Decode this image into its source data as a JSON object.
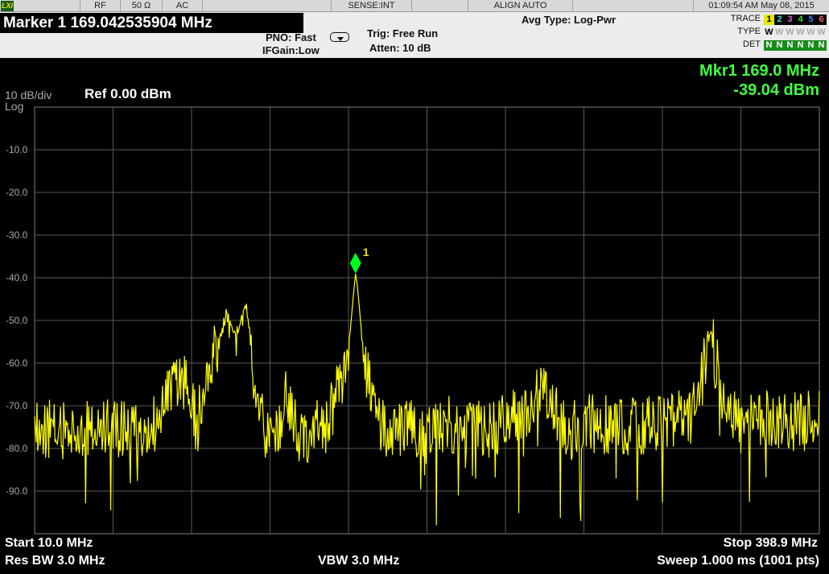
{
  "status_bar": {
    "logo": "LXI",
    "rf": "RF",
    "impedance": "50 Ω",
    "coupling": "AC",
    "sense": "SENSE:INT",
    "align": "ALIGN AUTO",
    "timestamp": "01:09:54 AM May 08, 2015"
  },
  "settings": {
    "marker_title": "Marker 1 169.042535904 MHz",
    "pno": "PNO: Fast",
    "ifgain": "IFGain:Low",
    "trig": "Trig: Free Run",
    "atten": "Atten: 10 dB",
    "avg_type": "Avg Type: Log-Pwr",
    "trace_label": "TRACE",
    "type_label": "TYPE",
    "det_label": "DET",
    "trace_numbers": [
      "1",
      "2",
      "3",
      "4",
      "5",
      "6"
    ],
    "trace_colors": [
      "#e8e800",
      "#40e0e0",
      "#e060e0",
      "#40e040",
      "#4080ff",
      "#ff6060"
    ],
    "type_values": [
      "W",
      "W",
      "W",
      "W",
      "W",
      "W"
    ],
    "det_values": [
      "N",
      "N",
      "N",
      "N",
      "N",
      "N"
    ]
  },
  "display": {
    "scale": "10 dB/div",
    "log": "Log",
    "ref": "Ref 0.00 dBm",
    "marker_readout_freq": "Mkr1 169.0 MHz",
    "marker_readout_amp": "-39.04 dBm",
    "marker_label": "1",
    "y_tick_labels": [
      "-10.0",
      "-20.0",
      "-30.0",
      "-40.0",
      "-50.0",
      "-60.0",
      "-70.0",
      "-80.0",
      "-90.0"
    ],
    "start": "Start 10.0 MHz",
    "stop": "Stop 398.9 MHz",
    "res_bw": "Res BW 3.0 MHz",
    "vbw": "VBW 3.0 MHz",
    "sweep": "Sweep  1.000 ms (1001 pts)"
  },
  "chart_data": {
    "type": "line",
    "x_start_mhz": 10.0,
    "x_stop_mhz": 398.9,
    "ylim": [
      -100,
      0
    ],
    "grid": true,
    "series_color": "#ffff00",
    "marker": {
      "x_mhz": 169.04,
      "y_dbm": -39.04
    },
    "series": [
      {
        "x_mhz": [
          10,
          25,
          40,
          55,
          70,
          75,
          85,
          90,
          95,
          100,
          105,
          110,
          115,
          120,
          125,
          130,
          135,
          140,
          145,
          155,
          165,
          168,
          169.04,
          170,
          173,
          180,
          190,
          205,
          220,
          235,
          250,
          260,
          265,
          270,
          275,
          285,
          300,
          320,
          335,
          340,
          345,
          350,
          360,
          375,
          390,
          398.9
        ],
        "y_dbm": [
          -75,
          -76,
          -75,
          -76,
          -74,
          -66,
          -64,
          -74,
          -63,
          -57,
          -49,
          -52,
          -48,
          -66,
          -77,
          -76,
          -68,
          -76,
          -77,
          -74,
          -60,
          -44,
          -39,
          -42,
          -58,
          -75,
          -76,
          -75,
          -74,
          -76,
          -72,
          -68,
          -66,
          -74,
          -76,
          -74,
          -75,
          -74,
          -73,
          -66,
          -52,
          -66,
          -75,
          -73,
          -74,
          -72
        ]
      }
    ]
  }
}
